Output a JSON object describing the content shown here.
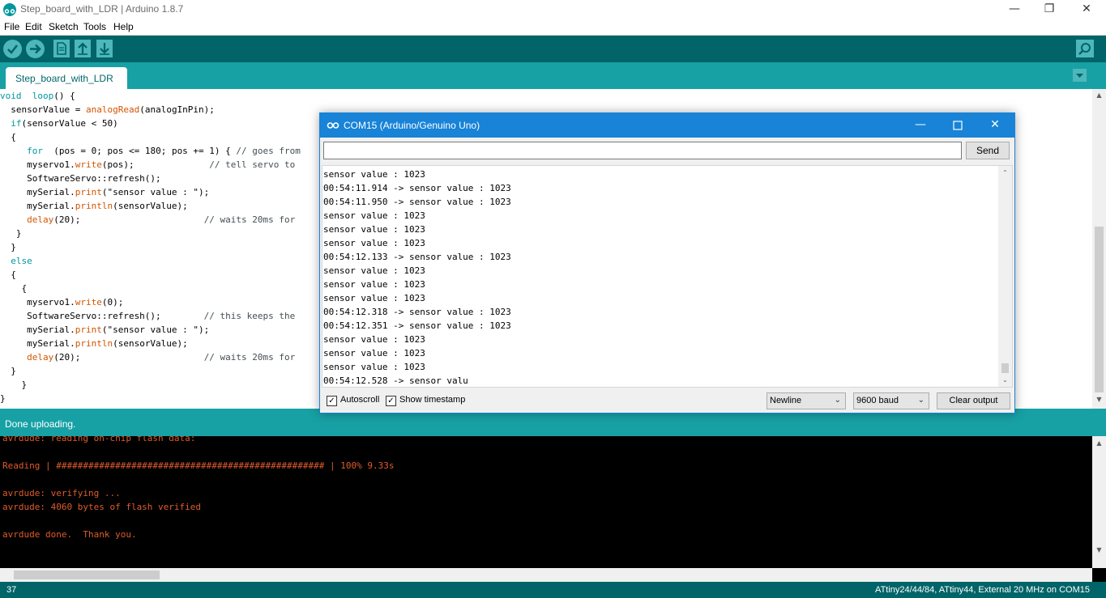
{
  "window": {
    "title": "Step_board_with_LDR | Arduino 1.8.7",
    "minimize": "—",
    "restore": "❐",
    "close": "✕"
  },
  "menu": [
    "File",
    "Edit",
    "Sketch",
    "Tools",
    "Help"
  ],
  "toolbar": {
    "verify_icon": "check-icon",
    "upload_icon": "arrow-right-icon",
    "new_icon": "file-icon",
    "open_icon": "arrow-up-icon",
    "save_icon": "arrow-down-icon",
    "serial_icon": "magnifier-icon"
  },
  "tabs": {
    "active": "Step_board_with_LDR",
    "menu_arrow": "▼"
  },
  "editor": {
    "lines": [
      [
        [
          "kw",
          "void"
        ],
        [
          "",
          "  "
        ],
        [
          "kw",
          "loop"
        ],
        [
          "",
          "() {"
        ]
      ],
      [
        [
          "",
          "  sensorValue = "
        ],
        [
          "fn",
          "analogRead"
        ],
        [
          "",
          "(analogInPin);"
        ]
      ],
      [
        [
          "",
          "  "
        ],
        [
          "kw",
          "if"
        ],
        [
          "",
          "(sensorValue < 50)"
        ]
      ],
      [
        [
          "",
          "  {"
        ]
      ],
      [
        [
          "",
          "     "
        ],
        [
          "kw",
          "for"
        ],
        [
          "",
          "  (pos = 0; pos <= 180; pos += 1) { "
        ],
        [
          "cm",
          "// goes from"
        ]
      ],
      [
        [
          "",
          "     myservo1."
        ],
        [
          "fn",
          "write"
        ],
        [
          "",
          "(pos);              "
        ],
        [
          "cm",
          "// tell servo to"
        ]
      ],
      [
        [
          "",
          "     SoftwareServo::refresh();"
        ]
      ],
      [
        [
          "",
          "     mySerial."
        ],
        [
          "fn",
          "print"
        ],
        [
          "",
          "(\"sensor value : \");"
        ]
      ],
      [
        [
          "",
          "     mySerial."
        ],
        [
          "fn",
          "println"
        ],
        [
          "",
          "(sensorValue);"
        ]
      ],
      [
        [
          "",
          "     "
        ],
        [
          "fn",
          "delay"
        ],
        [
          "",
          "(20);                       "
        ],
        [
          "cm",
          "// waits 20ms for"
        ]
      ],
      [
        [
          "",
          "   }"
        ]
      ],
      [
        [
          "",
          "  }"
        ]
      ],
      [
        [
          "",
          "  "
        ],
        [
          "kw",
          "else"
        ]
      ],
      [
        [
          "",
          "  {"
        ]
      ],
      [
        [
          "",
          "    {"
        ]
      ],
      [
        [
          "",
          "     myservo1."
        ],
        [
          "fn",
          "write"
        ],
        [
          "",
          "(0);"
        ]
      ],
      [
        [
          "",
          "     SoftwareServo::refresh();        "
        ],
        [
          "cm",
          "// this keeps the"
        ]
      ],
      [
        [
          "",
          "     mySerial."
        ],
        [
          "fn",
          "print"
        ],
        [
          "",
          "(\"sensor value : \");"
        ]
      ],
      [
        [
          "",
          "     mySerial."
        ],
        [
          "fn",
          "println"
        ],
        [
          "",
          "(sensorValue);"
        ]
      ],
      [
        [
          "",
          "     "
        ],
        [
          "fn",
          "delay"
        ],
        [
          "",
          "(20);                       "
        ],
        [
          "cm",
          "// waits 20ms for"
        ]
      ],
      [
        [
          "",
          "  }"
        ]
      ],
      [
        [
          "",
          "    }"
        ]
      ],
      [
        [
          "",
          "}"
        ]
      ]
    ]
  },
  "status": {
    "message": "Done uploading."
  },
  "console": {
    "lines": [
      "avrdude: reading on-chip flash data:",
      "",
      "Reading | ################################################## | 100% 9.33s",
      "",
      "avrdude: verifying ...",
      "avrdude: 4060 bytes of flash verified",
      "",
      "avrdude done.  Thank you."
    ]
  },
  "bottom": {
    "line_number": "37",
    "board": "ATtiny24/44/84, ATtiny44, External 20 MHz on COM15"
  },
  "serial_monitor": {
    "title": "COM15 (Arduino/Genuino Uno)",
    "input_value": "",
    "send_label": "Send",
    "output": [
      "sensor value : 1023",
      "00:54:11.914 -> sensor value : 1023",
      "00:54:11.950 -> sensor value : 1023",
      "sensor value : 1023",
      "sensor value : 1023",
      "sensor value : 1023",
      "00:54:12.133 -> sensor value : 1023",
      "sensor value : 1023",
      "sensor value : 1023",
      "sensor value : 1023",
      "00:54:12.318 -> sensor value : 1023",
      "00:54:12.351 -> sensor value : 1023",
      "sensor value : 1023",
      "sensor value : 1023",
      "sensor value : 1023",
      "00:54:12.528 -> sensor valu"
    ],
    "autoscroll_label": "Autoscroll",
    "autoscroll_checked": true,
    "timestamp_label": "Show timestamp",
    "timestamp_checked": true,
    "line_ending": "Newline",
    "baud": "9600 baud",
    "clear_label": "Clear output",
    "check_mark": "✓",
    "combo_arrow": "⌄"
  },
  "colors": {
    "teal_dark": "#006468",
    "teal": "#17a1a5",
    "accent_blue": "#1883d7",
    "console_text": "#e05c2a"
  }
}
